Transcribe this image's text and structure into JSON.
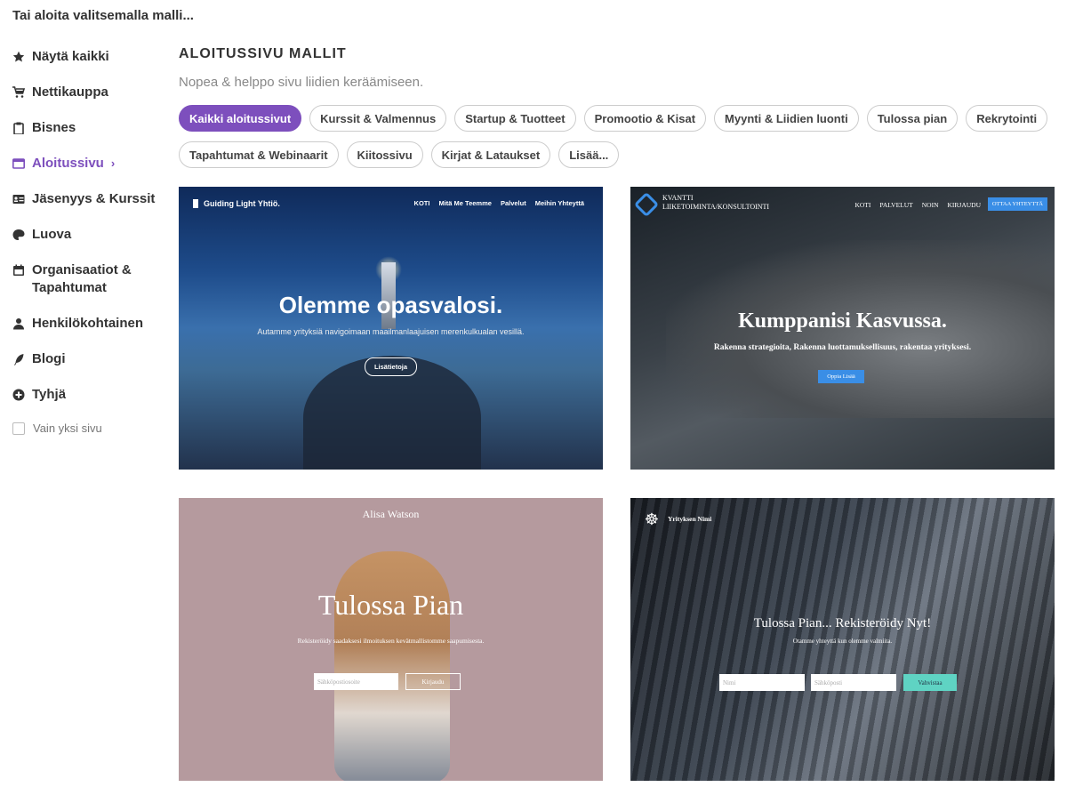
{
  "top_title": "Tai aloita valitsemalla malli...",
  "sidebar": {
    "items": [
      {
        "label": "Näytä kaikki",
        "icon": "star-icon"
      },
      {
        "label": "Nettikauppa",
        "icon": "cart-icon"
      },
      {
        "label": "Bisnes",
        "icon": "clipboard-icon"
      },
      {
        "label": "Aloitussivu",
        "icon": "window-icon",
        "active": true
      },
      {
        "label": "Jäsenyys & Kurssit",
        "icon": "id-card-icon"
      },
      {
        "label": "Luova",
        "icon": "palette-icon"
      },
      {
        "label": "Organisaatiot & Tapahtumat",
        "icon": "calendar-icon"
      },
      {
        "label": "Henkilökohtainen",
        "icon": "user-icon"
      },
      {
        "label": "Blogi",
        "icon": "feather-icon"
      },
      {
        "label": "Tyhjä",
        "icon": "plus-circle-icon"
      }
    ],
    "checkbox_label": "Vain yksi sivu",
    "active_color": "#7d4fbd"
  },
  "main": {
    "heading": "ALOITUSSIVU MALLIT",
    "subheading": "Nopea & helppo sivu liidien keräämiseen.",
    "chips": [
      "Kaikki aloitussivut",
      "Kurssit & Valmennus",
      "Startup & Tuotteet",
      "Promootio & Kisat",
      "Myynti & Liidien luonti",
      "Tulossa pian",
      "Rekrytointi",
      "Tapahtumat & Webinaarit",
      "Kiitossivu",
      "Kirjat & Lataukset",
      "Lisää..."
    ],
    "active_chip_index": 0
  },
  "templates": {
    "card1": {
      "brand": "Guiding Light Yhtiö.",
      "nav": [
        "KOTI",
        "Mitä Me Teemme",
        "Palvelut",
        "Meihin Yhteyttä"
      ],
      "title": "Olemme opasvalosi.",
      "subtitle": "Autamme yrityksiä navigoimaan maailmanlaajuisen merenkulkualan vesillä.",
      "button": "Lisätietoja"
    },
    "card2": {
      "brand_line1": "KVANTTI",
      "brand_line2": "LIIKETOIMINTA/KONSULTOINTI",
      "nav": [
        "KOTI",
        "PALVELUT",
        "NOIN",
        "KIRJAUDU"
      ],
      "contact": "OTTAA YHTEYTTÄ",
      "title": "Kumppanisi Kasvussa.",
      "subtitle": "Rakenna strategioita, Rakenna luottamuksellisuus, rakentaa yrityksesi.",
      "button": "Oppia Lisää"
    },
    "card3": {
      "name": "Alisa Watson",
      "title": "Tulossa Pian",
      "subtitle": "Rekisteröidy saadaksesi ilmoituksen kevätmallistomme saapumisesta.",
      "input_placeholder": "Sähköpostiosoite",
      "button": "Kirjaudu"
    },
    "card4": {
      "brand": "Yrityksen Nimi",
      "title": "Tulossa Pian... Rekisteröidy Nyt!",
      "subtitle": "Otamme yhteyttä kun olemme valmiita.",
      "input1_placeholder": "Nimi",
      "input2_placeholder": "Sähköposti",
      "button": "Vahvistaa"
    }
  }
}
